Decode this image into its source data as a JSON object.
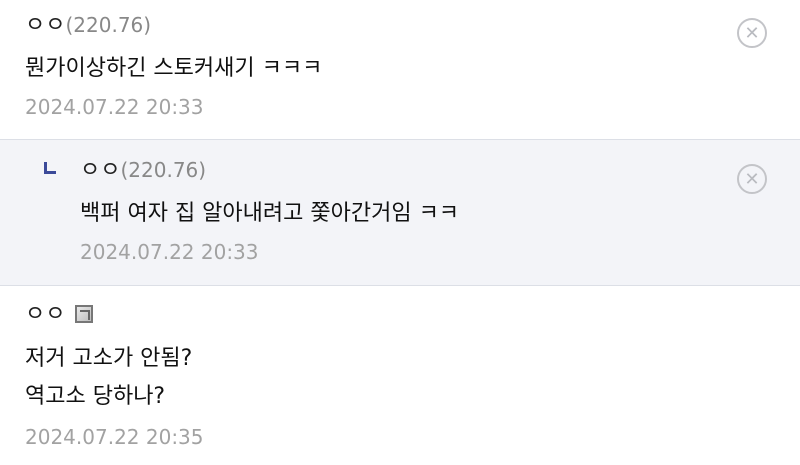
{
  "comments": [
    {
      "nick": "ㅇㅇ",
      "ip": "(220.76)",
      "lines": [
        "뭔가이상하긴 스토커새기 ㅋㅋㅋ"
      ],
      "date": "2024.07.22 20:33",
      "delete_icon": "close-circle-icon"
    },
    {
      "nick": "ㅇㅇ",
      "ip": "(220.76)",
      "lines": [
        "백퍼 여자 집 알아내려고 쫓아간거임 ㅋㅋ"
      ],
      "date": "2024.07.22 20:33",
      "delete_icon": "close-circle-icon",
      "reply_icon": "reply-arrow-icon"
    },
    {
      "nick": "ㅇㅇ",
      "member_icon": "member-badge-icon",
      "lines": [
        "저거 고소가 안됨?",
        "역고소 당하나?"
      ],
      "date": "2024.07.22 20:35"
    }
  ]
}
